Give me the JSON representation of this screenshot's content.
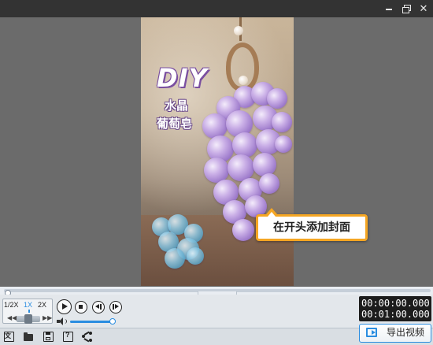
{
  "window": {
    "minimize_icon": "minimize-icon",
    "maximize_icon": "restore-icon",
    "close_icon": "close-icon",
    "close_glyph": "✕"
  },
  "preview": {
    "title_overlay": "DIY",
    "subtitle_line1": "水晶",
    "subtitle_line2": "葡萄皂",
    "cover_tag": "在开头添加封面"
  },
  "timeline": {
    "collapse_glyph": "⌄",
    "position_fraction": 0.0
  },
  "playback": {
    "speed_options": [
      "1/2X",
      "1X",
      "2X"
    ],
    "active_speed": "1X",
    "step_back_glyph": "◀◀",
    "step_forward_glyph": "▶▶",
    "controls": [
      "play-icon",
      "stop-icon",
      "prev-frame-icon",
      "next-frame-icon"
    ],
    "volume_icon": "volume-icon",
    "volume_fraction": 1.0,
    "current_time": "00:00:00.000",
    "total_time": "00:01:00.000"
  },
  "toolbar": {
    "tools": [
      "cover-icon",
      "open-folder-icon",
      "save-icon",
      "save-as-icon",
      "share-icon"
    ],
    "export_label": "导出视频"
  },
  "colors": {
    "accent": "#2a8de0",
    "tag_border": "#f5a623",
    "titlebar": "#333333",
    "viewer_bg": "#6b6b6b"
  }
}
